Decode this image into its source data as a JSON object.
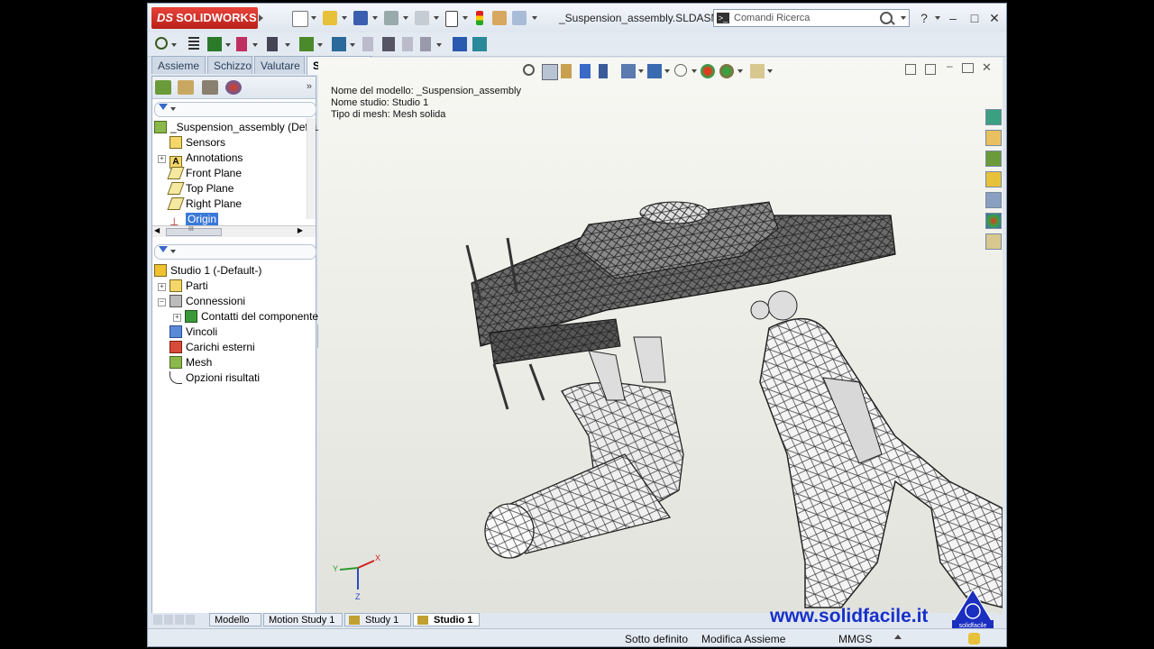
{
  "app": {
    "logo_prefix": "DS",
    "logo_text": "SOLIDWORKS",
    "doc_title": "_Suspension_assembly.SLDASM *",
    "search_placeholder": "Comandi Ricerca",
    "help_label": "?",
    "win_min": "–",
    "win_max": "□",
    "win_close": "✕"
  },
  "tabs": [
    {
      "label": "Assieme"
    },
    {
      "label": "Schizzo"
    },
    {
      "label": "Valutare"
    },
    {
      "label": "Simulation"
    }
  ],
  "feature_tree": {
    "root": "_Suspension_assembly  (Defau",
    "items": [
      {
        "label": "Sensors",
        "icon": "sensor-icon"
      },
      {
        "label": "Annotations",
        "icon": "annotation-icon"
      },
      {
        "label": "Front Plane",
        "icon": "plane-icon"
      },
      {
        "label": "Top Plane",
        "icon": "plane-icon"
      },
      {
        "label": "Right Plane",
        "icon": "plane-icon"
      },
      {
        "label": "Origin",
        "icon": "origin-icon"
      }
    ],
    "scroll_marker": "III"
  },
  "study_tree": {
    "root": "Studio 1 (-Default-)",
    "items": [
      {
        "label": "Parti"
      },
      {
        "label": "Connessioni"
      },
      {
        "label": "Contatti del componente"
      },
      {
        "label": "Vincoli"
      },
      {
        "label": "Carichi esterni"
      },
      {
        "label": "Mesh"
      },
      {
        "label": "Opzioni risultati"
      }
    ]
  },
  "viewport_info": {
    "model_name": "Nome del modello: _Suspension_assembly",
    "study_name": "Nome studio: Studio 1",
    "mesh_type": "Tipo di mesh: Mesh solida"
  },
  "triad": {
    "x": "X",
    "y": "Y",
    "z": "Z"
  },
  "bottom_tabs": [
    {
      "label": "Modello"
    },
    {
      "label": "Motion Study 1"
    },
    {
      "label": "Study 1"
    },
    {
      "label": "Studio 1"
    }
  ],
  "status_bar": {
    "state": "Sotto definito",
    "mode": "Modifica Assieme",
    "units": "MMGS"
  },
  "watermark": {
    "url": "www.solidfacile.it",
    "logo_text": "solidfacile"
  },
  "colors": {
    "accent": "#3a78d8",
    "brand_red": "#d42e26",
    "watermark_blue": "#1830c8"
  }
}
